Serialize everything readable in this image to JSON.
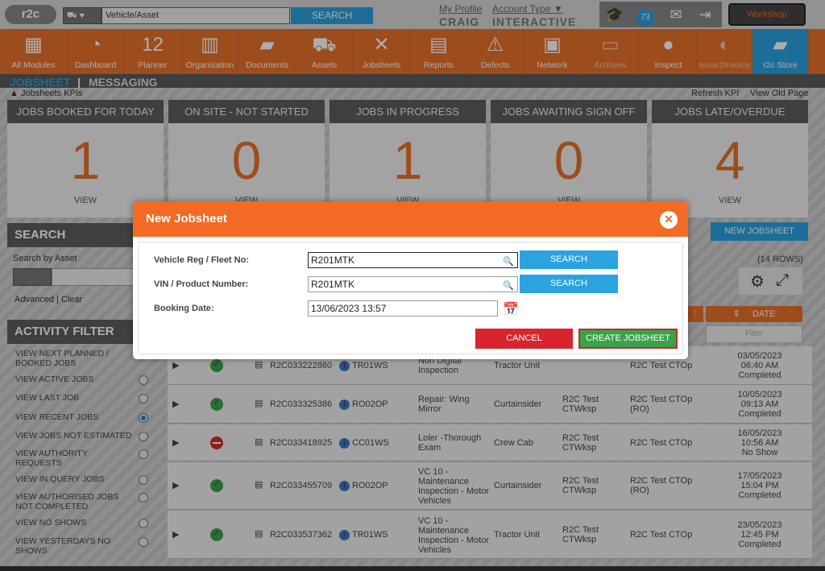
{
  "header": {
    "logo": "r2c",
    "vehicle_input": "Vehicle/Asset",
    "search_label": "SEARCH",
    "my_profile": "My Profile",
    "user_name": "CRAIG",
    "account_type": "Account Type",
    "account_value": "INTERACTIVE",
    "badge_count": "73",
    "workshop": "Workshop"
  },
  "nav": [
    {
      "label": "All Modules",
      "icon": "grid-icon",
      "glyph": "▦"
    },
    {
      "label": "Dashboard",
      "icon": "gauge-icon",
      "glyph": "◔"
    },
    {
      "label": "Planner",
      "icon": "calendar-icon",
      "glyph": "12"
    },
    {
      "label": "Organisation",
      "icon": "building-icon",
      "glyph": "▥"
    },
    {
      "label": "Documents",
      "icon": "folder-icon",
      "glyph": "▰"
    },
    {
      "label": "Assets",
      "icon": "truck-icon",
      "glyph": "⛟"
    },
    {
      "label": "Jobsheets",
      "icon": "tools-icon",
      "glyph": "✕"
    },
    {
      "label": "Reports",
      "icon": "clipboard-icon",
      "glyph": "▤"
    },
    {
      "label": "Defects",
      "icon": "warning-icon",
      "glyph": "⚠"
    },
    {
      "label": "Network",
      "icon": "contact-card-icon",
      "glyph": "▣"
    },
    {
      "label": "Archives",
      "icon": "archive-icon",
      "glyph": "▭"
    },
    {
      "label": "Inspect",
      "icon": "inspect-icon",
      "glyph": "●"
    },
    {
      "label": "Issue2Invoice",
      "icon": "invoice-icon",
      "glyph": "◐"
    },
    {
      "label": "r2c Store",
      "icon": "briefcase-icon",
      "glyph": "▰"
    }
  ],
  "subnav": {
    "jobsheet": "JOBSHEET",
    "sep": "|",
    "messaging": "MESSAGING"
  },
  "kpi_bar": {
    "toggle": "Jobsheets KPIs",
    "refresh": "Refresh KPI",
    "old_page": "View Old Page"
  },
  "kpis": [
    {
      "title": "JOBS BOOKED FOR TODAY",
      "value": "1",
      "view": "VIEW"
    },
    {
      "title": "ON SITE - NOT STARTED",
      "value": "0",
      "view": "VIEW"
    },
    {
      "title": "JOBS IN PROGRESS",
      "value": "1",
      "view": "VIEW"
    },
    {
      "title": "JOBS AWAITING SIGN OFF",
      "value": "0",
      "view": "VIEW"
    },
    {
      "title": "JOBS LATE/OVERDUE",
      "value": "4",
      "view": "VIEW"
    }
  ],
  "left": {
    "search_title": "SEARCH",
    "search_by": "Search by Asset",
    "advanced": "Advanced | Clear",
    "activity_title": "ACTIVITY FILTER",
    "filters": [
      {
        "label": "VIEW NEXT PLANNED / BOOKED JOBS",
        "radio": false,
        "selected": false
      },
      {
        "label": "VIEW ACTIVE JOBS",
        "radio": true,
        "selected": false
      },
      {
        "label": "VIEW LAST JOB",
        "radio": true,
        "selected": false
      },
      {
        "label": "VIEW RECENT JOBS",
        "radio": true,
        "selected": true
      },
      {
        "label": "VIEW JOBS NOT ESTIMATED",
        "radio": true,
        "selected": false
      },
      {
        "label": "VIEW AUTHORITY REQUESTS",
        "radio": true,
        "selected": false
      },
      {
        "label": "VIEW IN QUERY JOBS",
        "radio": true,
        "selected": false
      },
      {
        "label": "VIEW AUTHORISED JOBS NOT COMPLETED",
        "radio": true,
        "selected": false
      },
      {
        "label": "VIEW NO SHOWS",
        "radio": true,
        "selected": false
      },
      {
        "label": "VIEW YESTERDAYS NO SHOWS",
        "radio": true,
        "selected": false
      }
    ]
  },
  "table": {
    "new_jobsheet": "NEW JOBSHEET",
    "rows_count": "(14 ROWS)",
    "date_header": "DATE",
    "filter_placeholder": "Filter",
    "rows": [
      {
        "status": "ok",
        "ref": "R2C033222860",
        "reg": "TR01WS",
        "desc": "Non Digital Inspection",
        "type": "Tractor Unit",
        "wksp": "",
        "op": "R2C Test CTOp",
        "date": "03/05/2023",
        "time": "06:40 AM",
        "state": "Completed"
      },
      {
        "status": "ok",
        "ref": "R2C033325386",
        "reg": "RO02OP",
        "desc": "Repair: Wing Mirror",
        "type": "Curtainsider",
        "wksp": "R2C Test CTWksp",
        "op": "R2C Test CTOp (RO)",
        "date": "10/05/2023",
        "time": "09:13 AM",
        "state": "Completed"
      },
      {
        "status": "no",
        "ref": "R2C033418925",
        "reg": "CC01WS",
        "desc": "Loler -Thorough Exam",
        "type": "Crew Cab",
        "wksp": "R2C Test CTWksp",
        "op": "R2C Test CTOp",
        "date": "16/05/2023",
        "time": "10:56 AM",
        "state": "No Show"
      },
      {
        "status": "ok",
        "ref": "R2C033455709",
        "reg": "RO02OP",
        "desc": "VC 10 - Maintenance Inspection - Motor Vehicles",
        "type": "Curtainsider",
        "wksp": "R2C Test CTWksp",
        "op": "R2C Test CTOp (RO)",
        "date": "17/05/2023",
        "time": "15:04 PM",
        "state": "Completed"
      },
      {
        "status": "ok",
        "ref": "R2C033537362",
        "reg": "TR01WS",
        "desc": "VC 10 - Maintenance Inspection - Motor Vehicles",
        "type": "Tractor Unit",
        "wksp": "R2C Test CTWksp",
        "op": "R2C Test CTOp",
        "date": "23/05/2023",
        "time": "12:45 PM",
        "state": "Completed"
      }
    ]
  },
  "dialog": {
    "title": "New Jobsheet",
    "vehicle_label": "Vehicle Reg / Fleet No:",
    "vehicle_value": "R201MTK",
    "vin_label": "VIN / Product Number:",
    "vin_value": "R201MTK",
    "booking_label": "Booking Date:",
    "booking_value": "13/06/2023 13:57",
    "search": "SEARCH",
    "cancel": "CANCEL",
    "create": "CREATE JOBSHEET"
  },
  "colors": {
    "accent_orange": "#e8702a",
    "accent_blue": "#2aa3e0",
    "ok_green": "#3aa24a",
    "cancel_red": "#d8242c"
  }
}
